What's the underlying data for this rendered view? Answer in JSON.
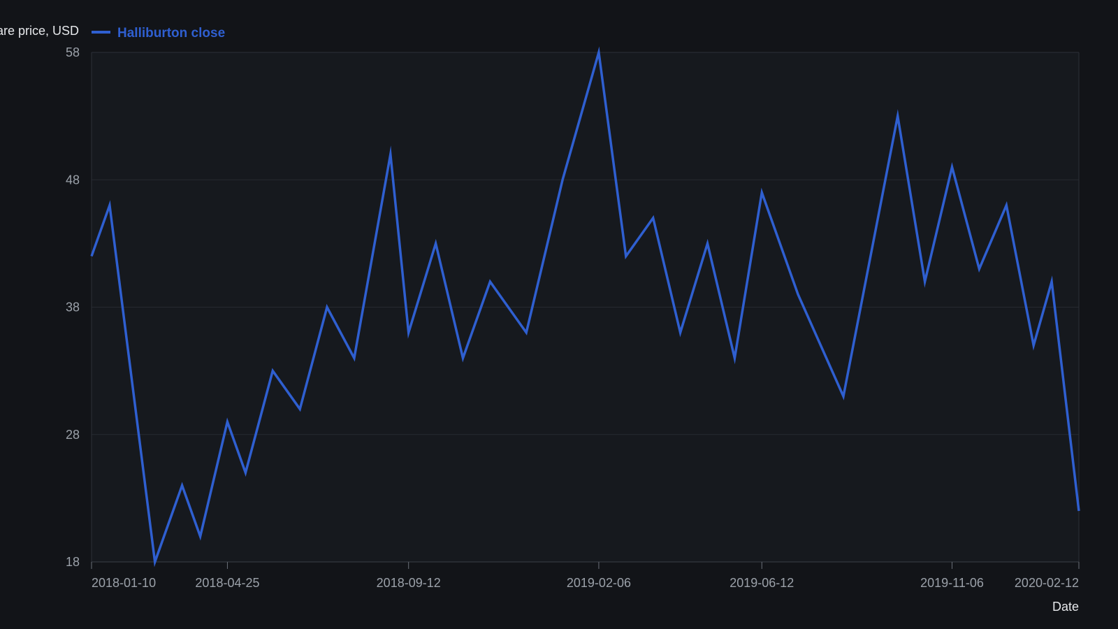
{
  "chart_data": {
    "type": "line",
    "ylabel": "Share price, USD",
    "xlabel": "Date",
    "legend": {
      "position": "top-left",
      "entries": [
        "Halliburton close"
      ]
    },
    "grid": {
      "horizontal": true,
      "vertical": false
    },
    "xlim": [
      "2018-01-10",
      "2020-02-12"
    ],
    "ylim": [
      18,
      58
    ],
    "y_ticks": [
      58,
      48,
      38,
      28,
      18
    ],
    "x_ticks": [
      "2018-01-10",
      "2018-04-25",
      "2018-09-12",
      "2019-02-06",
      "2019-06-12",
      "2019-11-06",
      "2020-02-12"
    ],
    "series": [
      {
        "name": "Halliburton close",
        "color": "#2f5fd0",
        "points": [
          {
            "x": "2018-01-10",
            "y": 42.0
          },
          {
            "x": "2018-01-24",
            "y": 46.0
          },
          {
            "x": "2018-02-28",
            "y": 18.0
          },
          {
            "x": "2018-03-21",
            "y": 24.0
          },
          {
            "x": "2018-04-04",
            "y": 20.0
          },
          {
            "x": "2018-04-25",
            "y": 29.0
          },
          {
            "x": "2018-05-09",
            "y": 25.0
          },
          {
            "x": "2018-05-30",
            "y": 33.0
          },
          {
            "x": "2018-06-20",
            "y": 30.0
          },
          {
            "x": "2018-07-11",
            "y": 38.0
          },
          {
            "x": "2018-08-01",
            "y": 34.0
          },
          {
            "x": "2018-08-29",
            "y": 50.0
          },
          {
            "x": "2018-09-12",
            "y": 36.0
          },
          {
            "x": "2018-10-03",
            "y": 43.0
          },
          {
            "x": "2018-10-24",
            "y": 34.0
          },
          {
            "x": "2018-11-14",
            "y": 40.0
          },
          {
            "x": "2018-12-12",
            "y": 36.0
          },
          {
            "x": "2019-01-09",
            "y": 48.0
          },
          {
            "x": "2019-02-06",
            "y": 58.0
          },
          {
            "x": "2019-02-27",
            "y": 42.0
          },
          {
            "x": "2019-03-20",
            "y": 45.0
          },
          {
            "x": "2019-04-10",
            "y": 36.0
          },
          {
            "x": "2019-05-01",
            "y": 43.0
          },
          {
            "x": "2019-05-22",
            "y": 34.0
          },
          {
            "x": "2019-06-12",
            "y": 47.0
          },
          {
            "x": "2019-07-10",
            "y": 39.0
          },
          {
            "x": "2019-08-14",
            "y": 31.0
          },
          {
            "x": "2019-09-25",
            "y": 53.0
          },
          {
            "x": "2019-10-16",
            "y": 40.0
          },
          {
            "x": "2019-11-06",
            "y": 49.0
          },
          {
            "x": "2019-11-27",
            "y": 41.0
          },
          {
            "x": "2019-12-18",
            "y": 46.0
          },
          {
            "x": "2020-01-08",
            "y": 35.0
          },
          {
            "x": "2020-01-22",
            "y": 40.0
          },
          {
            "x": "2020-02-12",
            "y": 22.0
          }
        ]
      }
    ]
  }
}
